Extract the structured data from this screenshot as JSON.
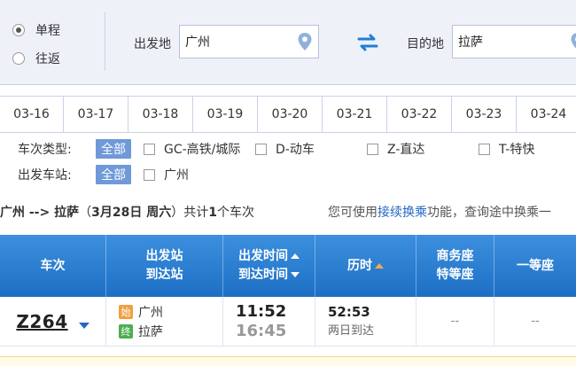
{
  "search": {
    "trip_types": [
      {
        "label": "单程",
        "checked": true
      },
      {
        "label": "往返",
        "checked": false
      }
    ],
    "from_label": "出发地",
    "from_value": "广州",
    "to_label": "目的地",
    "to_value": "拉萨"
  },
  "dates": [
    "03-16",
    "03-17",
    "03-18",
    "03-19",
    "03-20",
    "03-21",
    "03-22",
    "03-23",
    "03-24"
  ],
  "filters": {
    "type_label": "车次类型:",
    "type_all": "全部",
    "types": [
      "GC-高铁/城际",
      "D-动车",
      "Z-直达",
      "T-特快"
    ],
    "station_label": "出发车站:",
    "station_all": "全部",
    "stations": [
      "广州"
    ]
  },
  "summary": {
    "route": "广州 --> 拉萨",
    "date_open": "（",
    "date": "3月28日 周六",
    "date_close": "）",
    "total_prefix": "共计",
    "count": "1",
    "total_suffix": "个车次",
    "tip_prefix": "您可使用",
    "tip_link": "接续换乘",
    "tip_suffix": "功能，查询途中换乘一"
  },
  "table": {
    "headers": {
      "train": "车次",
      "from_station": "出发站",
      "to_station": "到达站",
      "depart_time": "出发时间",
      "arrive_time": "到达时间",
      "duration": "历时",
      "business_1": "商务座",
      "business_2": "特等座",
      "first_class": "一等座"
    },
    "rows": [
      {
        "train_no": "Z264",
        "from_badge": "始",
        "from_station": "广州",
        "to_badge": "终",
        "to_station": "拉萨",
        "depart": "11:52",
        "arrive": "16:45",
        "duration": "52:53",
        "arrive_note": "两日到达",
        "business": "--",
        "first": "--"
      }
    ]
  },
  "colors": {
    "header_blue": "#1d6fc4",
    "link_blue": "#2467c2",
    "start_badge": "#f0a040",
    "end_badge": "#4caf50",
    "sort_orange": "#f7a84a"
  }
}
